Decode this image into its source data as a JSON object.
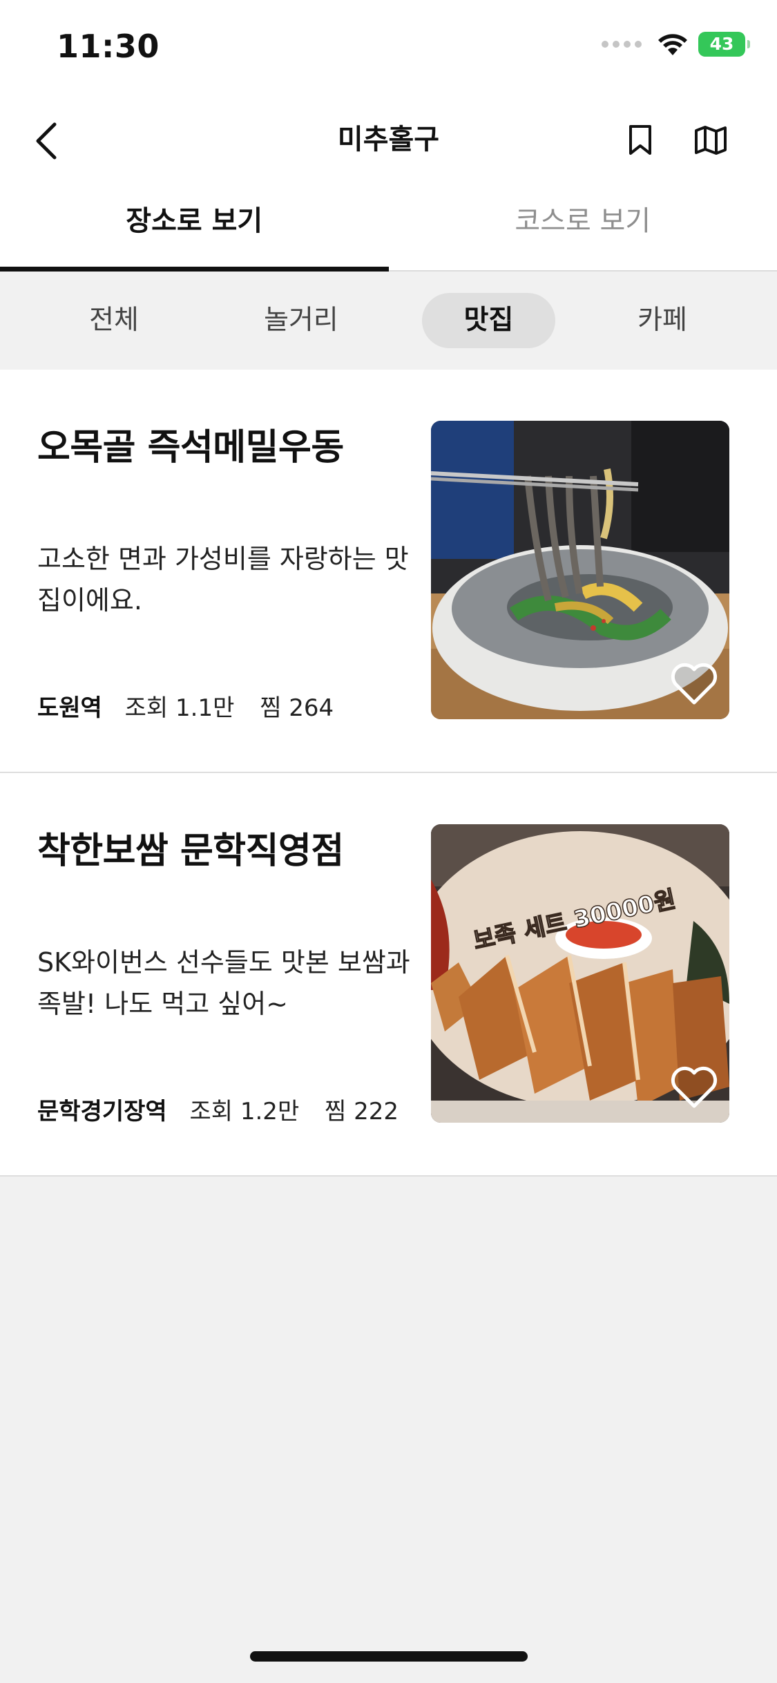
{
  "status_bar": {
    "time": "11:30",
    "battery": "43"
  },
  "nav": {
    "title": "미추홀구"
  },
  "tabs": [
    {
      "label": "장소로 보기",
      "active": true
    },
    {
      "label": "코스로 보기",
      "active": false
    }
  ],
  "categories": [
    {
      "label": "전체"
    },
    {
      "label": "놀거리"
    },
    {
      "label": "맛집",
      "selected": true
    },
    {
      "label": "카페"
    }
  ],
  "places": [
    {
      "title": "오목골 즉석메밀우동",
      "description": "고소한 면과 가성비를 자랑하는 맛집이에요.",
      "station": "도원역",
      "views": "조회 1.1만",
      "saves": "찜 264"
    },
    {
      "title": "착한보쌈 문학직영점",
      "description": "SK와이번스 선수들도 맛본 보쌈과 족발! 나도 먹고 싶어~",
      "station": "문학경기장역",
      "views": "조회 1.2만",
      "saves": "찜 222",
      "image_caption": "보족 세트 30000원"
    }
  ],
  "colors": {
    "accent": "#111111",
    "battery": "#34c759",
    "selected_chip": "#dfdfdf",
    "background": "#f1f1f1"
  }
}
